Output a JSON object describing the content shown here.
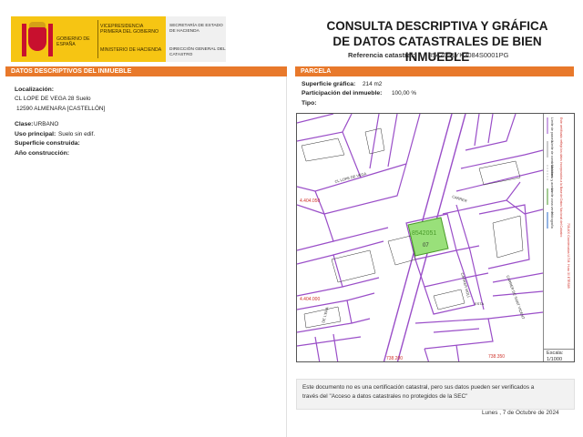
{
  "header": {
    "gov_left": "GOBIERNO DE ESPAÑA",
    "vicepresidencia": "VICEPRESIDENCIA PRIMERA DEL GOBIERNO",
    "ministerio": "MINISTERIO DE HACIENDA",
    "secretaria": "SECRETARÍA DE ESTADO DE HACIENDA",
    "direccion": "DIRECCIÓN GENERAL DEL CATASTRO",
    "title_line1": "CONSULTA DESCRIPTIVA Y GRÁFICA",
    "title_line2": "DE DATOS CATASTRALES DE BIEN INMUEBLE",
    "ref_label": "Referencia catastral:",
    "ref_value": "8542051YK3084S0001PG"
  },
  "left_section": {
    "heading": "DATOS DESCRIPTIVOS DEL INMUEBLE",
    "localizacion_label": "Localización:",
    "address_line1": "CL LOPE DE VEGA 28 Suelo",
    "address_line2": "12590 ALMENARA [CASTELLÓN]",
    "clase_label": "Clase:",
    "clase_value": "URBANO",
    "uso_label": "Uso principal:",
    "uso_value": "Suelo sin edif.",
    "superficie_label": "Superficie construida:",
    "anio_label": "Año construcción:"
  },
  "right_section": {
    "heading": "PARCELA",
    "sup_grafica_label": "Superficie gráfica:",
    "sup_grafica_value": "214 m2",
    "participacion_label": "Participación del inmueble:",
    "participacion_value": "100,00 %",
    "tipo_label": "Tipo:"
  },
  "map": {
    "coord_y1": "4.404.050",
    "coord_y2": "4.404.000",
    "coord_x1": "738.200",
    "coord_x2": "738.350",
    "parcel_label": "07",
    "parcel_code": "8542051",
    "street_labels": [
      "CL LOPE DE VEGA",
      "CARRER",
      "CARRER MOLÍ",
      "CARRER DE SANT VICENT",
      "ESTA",
      "DE L'ERA"
    ],
    "parcel_numbers": [
      "01",
      "02",
      "03",
      "05",
      "06",
      "08",
      "09",
      "10",
      "11",
      "12",
      "13",
      "14",
      "15",
      "16",
      "17",
      "18",
      "19",
      "20",
      "21",
      "22",
      "23",
      "24",
      "25",
      "26",
      "27",
      "28"
    ],
    "legend_lines": [
      "Límite de parcela",
      "Límite de construcciones",
      "Mobiliario y aceras",
      "Límite zona verde",
      "Hidrografía"
    ],
    "legend_note": "Este certificado refleja los datos incorporados a la Base de Datos Nacional del Catastro",
    "coords_note": "738,400 Coordenadas U.T.M. Huso 30 ETRS89",
    "scale_label": "Escala:",
    "scale_value": "1/1000",
    "parcel_color": "#99e07a",
    "line_color": "#9a4ec8"
  },
  "footer": {
    "disclaimer_line1": "Este documento no es una certificación catastral, pero sus datos pueden ser verificados a",
    "disclaimer_line2": "través del \"Acceso a datos catastrales no protegidos de la SEC\"",
    "date": "Lunes , 7 de Octubre de 2024"
  },
  "colors": {
    "accent": "#e8792b",
    "gov_yellow": "#f6c513"
  }
}
